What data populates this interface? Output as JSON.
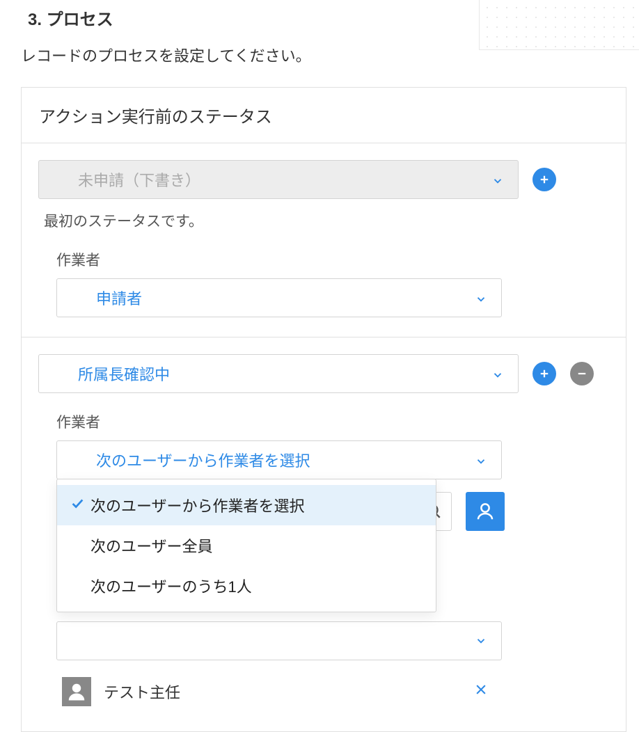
{
  "section": {
    "heading": "3. プロセス",
    "description": "レコードのプロセスを設定してください。"
  },
  "panel": {
    "header": "アクション実行前のステータス"
  },
  "status1": {
    "name": "未申請（下書き）",
    "hint": "最初のステータスです。",
    "worker_label": "作業者",
    "worker_value": "申請者"
  },
  "status2": {
    "name": "所属長確認中",
    "worker_label": "作業者",
    "worker_select": "次のユーザーから作業者を選択",
    "dropdown": {
      "options": [
        "次のユーザーから作業者を選択",
        "次のユーザー全員",
        "次のユーザーのうち1人"
      ]
    },
    "user": {
      "name": "テスト主任"
    }
  }
}
